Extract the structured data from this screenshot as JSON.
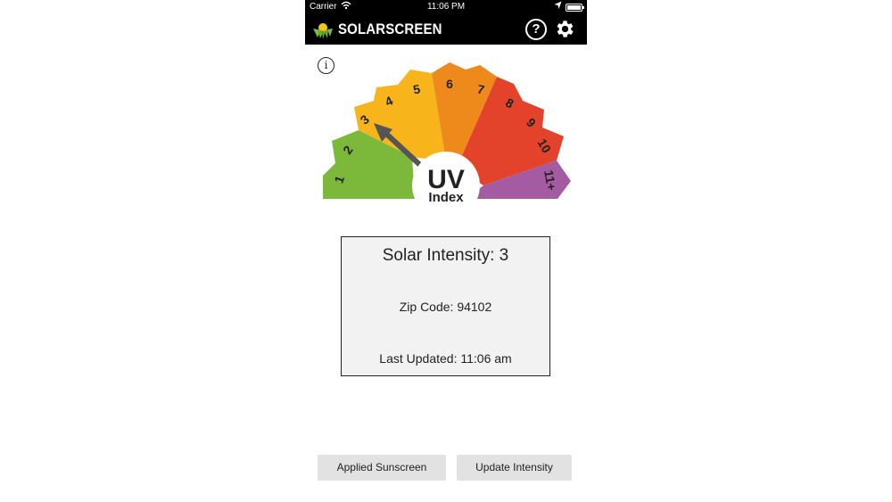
{
  "status_bar": {
    "carrier": "Carrier",
    "time": "11:06 PM"
  },
  "nav": {
    "brand": "SOLARSCREEN",
    "help_label": "?"
  },
  "info_label": "i",
  "gauge": {
    "segments": [
      "1",
      "2",
      "3",
      "4",
      "5",
      "6",
      "7",
      "8",
      "9",
      "10",
      "11+"
    ],
    "center_title": "UV",
    "center_subtitle": "Index",
    "current_index": 3,
    "colors": {
      "green": "#7cb83a",
      "yellow": "#f7b51b",
      "orange": "#ee8a1c",
      "red": "#e2432a",
      "purple": "#a45ba1",
      "needle": "#555555"
    }
  },
  "card": {
    "intensity_text": "Solar Intensity: 3",
    "zip_text": "Zip Code: 94102",
    "updated_text": "Last Updated: 11:06 am"
  },
  "buttons": {
    "applied_label": "Applied Sunscreen",
    "update_label": "Update Intensity"
  }
}
